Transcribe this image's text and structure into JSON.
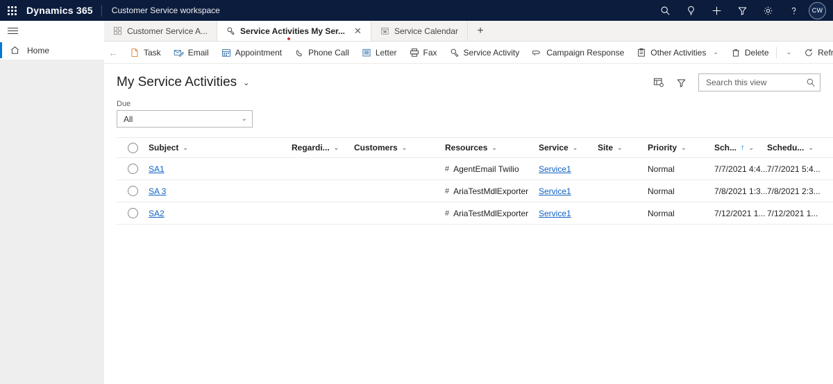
{
  "topbar": {
    "brand": "Dynamics 365",
    "app_name": "Customer Service workspace",
    "icons": [
      {
        "name": "search-icon",
        "glyph": "search"
      },
      {
        "name": "assistant-idea-icon",
        "glyph": "bulb"
      },
      {
        "name": "quick-create-icon",
        "glyph": "plus"
      },
      {
        "name": "filter-icon",
        "glyph": "funnel"
      },
      {
        "name": "settings-gear-icon",
        "glyph": "gear"
      },
      {
        "name": "help-icon",
        "glyph": "question"
      }
    ],
    "avatar_initials": "CW"
  },
  "sidebar": {
    "menu_icon": "hamburger-icon",
    "items": [
      {
        "label": "Home",
        "icon": "home-icon",
        "selected": true
      }
    ]
  },
  "tabs": [
    {
      "label": "Customer Service A...",
      "icon": "dashboard-icon",
      "active": false,
      "closable": false
    },
    {
      "label": "Service Activities My Ser...",
      "icon": "service-activity-icon",
      "active": true,
      "closable": true,
      "close_label": "✕"
    },
    {
      "label": "Service Calendar",
      "icon": "calendar-icon",
      "active": false,
      "closable": false
    }
  ],
  "new_tab_label": "+",
  "commandbar": {
    "back_label": "←",
    "items": [
      {
        "label": "Task",
        "icon": "task-icon"
      },
      {
        "label": "Email",
        "icon": "email-icon"
      },
      {
        "label": "Appointment",
        "icon": "appointment-icon"
      },
      {
        "label": "Phone Call",
        "icon": "phone-icon"
      },
      {
        "label": "Letter",
        "icon": "letter-icon"
      },
      {
        "label": "Fax",
        "icon": "fax-icon"
      },
      {
        "label": "Service Activity",
        "icon": "service-activity-icon"
      },
      {
        "label": "Campaign Response",
        "icon": "campaign-response-icon"
      },
      {
        "label": "Other Activities",
        "icon": "other-activities-icon",
        "chevron": "⌄"
      },
      {
        "label": "Delete",
        "icon": "trash-icon",
        "chevron": "⌄"
      },
      {
        "label": "Refresh",
        "icon": "refresh-icon"
      }
    ],
    "overflow_label": "⋮"
  },
  "view": {
    "title": "My Service Activities",
    "title_chevron": "⌄",
    "edit_columns_icon": "edit-columns-icon",
    "filter_icon": "filter-icon",
    "search": {
      "placeholder": "Search this view",
      "value": "",
      "icon": "search-icon"
    }
  },
  "due_filter": {
    "label": "Due",
    "value": "All",
    "chevron": "⌄"
  },
  "grid": {
    "select_all_name": "select-all-checkbox",
    "columns": [
      {
        "label": "Subject",
        "chevron": "⌄",
        "sorted": false
      },
      {
        "label": "Regardi...",
        "chevron": "⌄",
        "sorted": false
      },
      {
        "label": "Customers",
        "chevron": "⌄",
        "sorted": false
      },
      {
        "label": "Resources",
        "chevron": "⌄",
        "sorted": false
      },
      {
        "label": "Service",
        "chevron": "⌄",
        "sorted": false
      },
      {
        "label": "Site",
        "chevron": "⌄",
        "sorted": false
      },
      {
        "label": "Priority",
        "chevron": "⌄",
        "sorted": false
      },
      {
        "label": "Sch...",
        "chevron": "⌄",
        "sorted": true,
        "sort_arrow": "↑"
      },
      {
        "label": "Schedu...",
        "chevron": "⌄",
        "sorted": false
      }
    ],
    "rows": [
      {
        "subject": "SA1",
        "regarding": "",
        "customers": "",
        "resources": "AgentEmail Twilio",
        "resources_prefix": "#",
        "service": "Service1",
        "site": "",
        "priority": "Normal",
        "scheduled_start": "7/7/2021 4:4...",
        "scheduled_end": "7/7/2021 5:4..."
      },
      {
        "subject": "SA 3",
        "regarding": "",
        "customers": "",
        "resources": "AriaTestMdlExporter",
        "resources_prefix": "#",
        "service": "Service1",
        "site": "",
        "priority": "Normal",
        "scheduled_start": "7/8/2021 1:3...",
        "scheduled_end": "7/8/2021 2:3..."
      },
      {
        "subject": "SA2",
        "regarding": "",
        "customers": "",
        "resources": "AriaTestMdlExporter",
        "resources_prefix": "#",
        "service": "Service1",
        "site": "",
        "priority": "Normal",
        "scheduled_start": "7/12/2021 1...",
        "scheduled_end": "7/12/2021 1..."
      }
    ]
  },
  "colors": {
    "navbar": "#0b1c3d",
    "accent": "#0078d4",
    "link": "#0f62c4",
    "unsaved_dot": "#d13438",
    "sidebar_bg": "#eeeeee"
  }
}
